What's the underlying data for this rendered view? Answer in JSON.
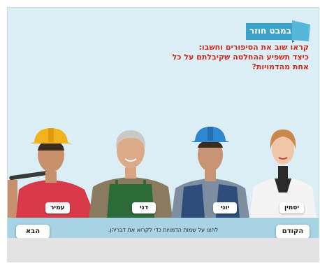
{
  "section_label": "במבט חוזר",
  "question_lines": [
    "קראו שוב את הסיפורים וחשבו:",
    "כיצד תשפיע ההחלטה שקיבלתם על כל",
    "אחת מהדמויות?"
  ],
  "characters": [
    "עמיר",
    "דני",
    "יוני",
    "יסמין"
  ],
  "instruction": "לחצו על שמות הדמויות כדי לקרוא את דבריהן.",
  "nav": {
    "next_label": "הבא",
    "prev_label": "הקודם"
  },
  "colors": {
    "tag": "#3aa3c9",
    "question": "#d42a1c",
    "background": "#dbeef5",
    "bar": "#a7d3e4"
  }
}
